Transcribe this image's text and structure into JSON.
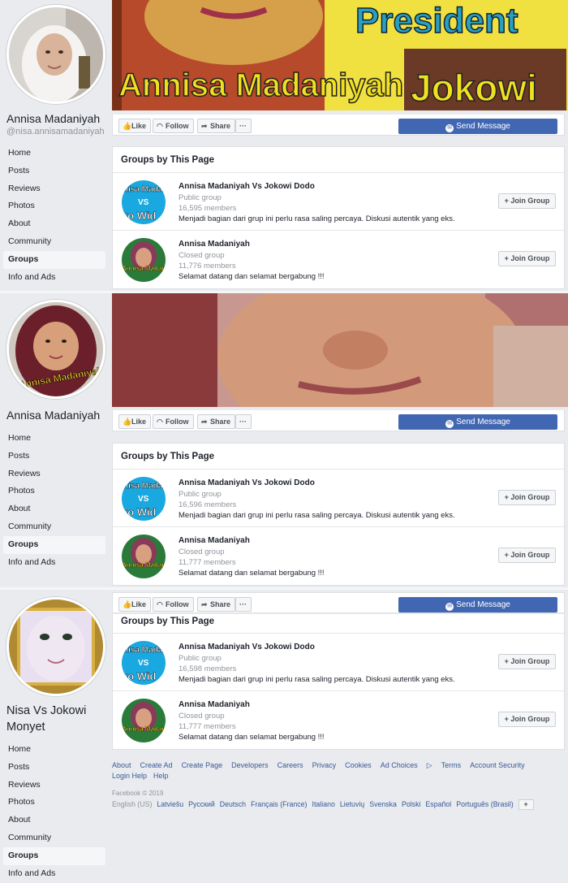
{
  "panels": [
    {
      "page_name": "Annisa Madaniyah",
      "handle": "@nisa.annisamadaniyah",
      "avatar_text": "",
      "cover_texts": [
        "President",
        "Annisa Madaniyah",
        "Jokowi"
      ],
      "nav": [
        "Home",
        "Posts",
        "Reviews",
        "Photos",
        "About",
        "Community",
        "Groups",
        "Info and Ads"
      ],
      "groups": [
        {
          "name": "Annisa Madaniyah Vs Jokowi Dodo",
          "type": "Public group",
          "members": "16,595 members",
          "desc": "Menjadi bagian dari grup ini perlu rasa saling percaya. Diskusi autentik yang eks..."
        },
        {
          "name": "Annisa Madaniyah",
          "type": "Closed group",
          "members": "11,776 members",
          "desc": "Selamat datang dan selamat bergabung !!!"
        }
      ]
    },
    {
      "page_name": "Annisa Madaniyah",
      "avatar_text": "Annisa Madaniyah",
      "nav": [
        "Home",
        "Posts",
        "Reviews",
        "Photos",
        "About",
        "Community",
        "Groups",
        "Info and Ads"
      ],
      "groups": [
        {
          "name": "Annisa Madaniyah Vs Jokowi Dodo",
          "type": "Public group",
          "members": "16,596 members",
          "desc": "Menjadi bagian dari grup ini perlu rasa saling percaya. Diskusi autentik yang eks..."
        },
        {
          "name": "Annisa Madaniyah",
          "type": "Closed group",
          "members": "11,777 members",
          "desc": "Selamat datang dan selamat bergabung !!!"
        }
      ]
    },
    {
      "page_name": "Nisa Vs Jokowi Monyet",
      "nav": [
        "Home",
        "Posts",
        "Reviews",
        "Photos",
        "About",
        "Community",
        "Groups",
        "Info and Ads"
      ],
      "groups": [
        {
          "name": "Annisa Madaniyah Vs Jokowi Dodo",
          "type": "Public group",
          "members": "16,598 members",
          "desc": "Menjadi bagian dari grup ini perlu rasa saling percaya. Diskusi autentik yang eks..."
        },
        {
          "name": "Annisa Madaniyah",
          "type": "Closed group",
          "members": "11,777 members",
          "desc": "Selamat datang dan selamat bergabung !!!"
        }
      ]
    }
  ],
  "actions": {
    "like": "Like",
    "follow": "Follow",
    "share": "Share",
    "more": "···",
    "send_message": "Send Message"
  },
  "groups_title": "Groups by This Page",
  "join_label": "+ Join Group",
  "thumb_public_text": [
    "nisa Madan",
    "VS",
    "ko Wid"
  ],
  "thumb_closed_text": "Annisa Madaniyah",
  "footer": {
    "links": [
      "About",
      "Create Ad",
      "Create Page",
      "Developers",
      "Careers",
      "Privacy",
      "Cookies",
      "Ad Choices",
      "Terms",
      "Account Security",
      "Login Help",
      "Help"
    ],
    "copyright": "Facebook © 2019",
    "current_language": "English (US)",
    "languages": [
      "Latviešu",
      "Русский",
      "Deutsch",
      "Français (France)",
      "Italiano",
      "Lietuvių",
      "Svenska",
      "Polski",
      "Español",
      "Português (Brasil)"
    ],
    "more": "+"
  },
  "colors": {
    "brand_blue": "#4267b2",
    "bg": "#e9ebee",
    "link": "#385898"
  }
}
